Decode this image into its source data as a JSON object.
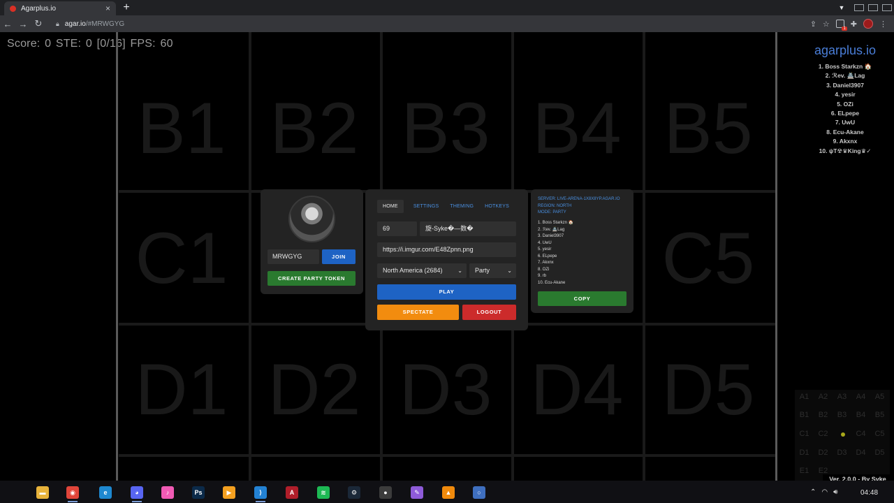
{
  "browser": {
    "tab_title": "Agarplus.io",
    "tab_close": "×",
    "new_tab": "+",
    "url_host": "agar.io",
    "url_path": "/#MRWGYG",
    "back": "←",
    "forward": "→",
    "reload": "↻",
    "extension_badge": "1"
  },
  "hud": {
    "text": "Score: 0  STE: 0  [0/16]  FPS: 60"
  },
  "sectors": {
    "row_b": [
      "B1",
      "B2",
      "B3",
      "B4",
      "B5"
    ],
    "row_c": [
      "C1",
      "C5"
    ],
    "row_d": [
      "D1",
      "D2",
      "D3",
      "D4",
      "D5"
    ]
  },
  "leaderboard": {
    "title": "agarplus.io",
    "entries": [
      "1. Boss Starkzn 🏠",
      "2. ℛev. 🏯Lag",
      "3. Daniel3907",
      "4. yesir",
      "5. OZi",
      "6. ELpepe",
      "7. UwU",
      "8. Ecu-Akane",
      "9. Akxnx",
      "10. ψT☢♛King♛✓"
    ]
  },
  "minimap": {
    "rows": [
      [
        "A1",
        "A2",
        "A3",
        "A4",
        "A5"
      ],
      [
        "B1",
        "B2",
        "B3",
        "B4",
        "B5"
      ],
      [
        "C1",
        "C2",
        "",
        "C4",
        "C5"
      ],
      [
        "D1",
        "D2",
        "D3",
        "D4",
        "D5"
      ],
      [
        "E1",
        "E2",
        "E3",
        "E4",
        "E5"
      ]
    ],
    "player_color": "#a8a81a"
  },
  "version": "Ver. 2.0.0 - By Syke",
  "party_panel": {
    "party_code": "MRWGYG",
    "join_label": "JOIN",
    "create_label": "CREATE PARTY TOKEN"
  },
  "main_panel": {
    "tabs": [
      "HOME",
      "SETTINGS",
      "THEMING",
      "HOTKEYS"
    ],
    "active_tab": "HOME",
    "tag_value": "69",
    "nick_value": "旋-Syke�—数�",
    "skin_value": "https://i.imgur.com/E48Zpnn.png",
    "region_value": "North America (2684)",
    "mode_value": "Party",
    "chevron": "⌄",
    "play_label": "PLAY",
    "spectate_label": "SPECTATE",
    "logout_label": "LOGOUT"
  },
  "server_panel": {
    "server": "SERVER: LIVE-ARENA-1X8X8YP.AGAR.IO",
    "region": "REGION: NORTH",
    "mode": "MODE: PARTY",
    "players": [
      "1. Boss Starkzn 🏠",
      "2. ℛev. 🏯Lag",
      "3. Daniel3907",
      "4. UwU",
      "5. yesir",
      "6. ELpepe",
      "7. Akxnx",
      "8. OZi",
      "9. rb",
      "10. Ecu-Akane"
    ],
    "copy_label": "COPY"
  },
  "taskbar": {
    "time": "04:48",
    "apps": [
      {
        "name": "apple-icon",
        "glyph": "",
        "color": "transparent"
      },
      {
        "name": "file-explorer-icon",
        "glyph": "▬",
        "color": "#e8b33b"
      },
      {
        "name": "chrome-icon",
        "glyph": "◉",
        "color": "#e0453a"
      },
      {
        "name": "edge-icon",
        "glyph": "e",
        "color": "#1e88d0"
      },
      {
        "name": "discord-icon",
        "glyph": "◕",
        "color": "#5865f2"
      },
      {
        "name": "itunes-icon",
        "glyph": "♪",
        "color": "#f15bb5"
      },
      {
        "name": "photoshop-icon",
        "glyph": "Ps",
        "color": "#0b2a49"
      },
      {
        "name": "media-player-icon",
        "glyph": "▶",
        "color": "#f4a020"
      },
      {
        "name": "vscode-icon",
        "glyph": "⟩",
        "color": "#2382d4"
      },
      {
        "name": "app-a-icon",
        "glyph": "A",
        "color": "#b01e2a"
      },
      {
        "name": "spotify-icon",
        "glyph": "≋",
        "color": "#1db954"
      },
      {
        "name": "steam-icon",
        "glyph": "⚙",
        "color": "#1b2838"
      },
      {
        "name": "obs-icon",
        "glyph": "●",
        "color": "#3c3c3c"
      },
      {
        "name": "feather-icon",
        "glyph": "✎",
        "color": "#8e5bd8"
      },
      {
        "name": "vlc-icon",
        "glyph": "▲",
        "color": "#f08a0c"
      },
      {
        "name": "circle-app-icon",
        "glyph": "○",
        "color": "#3f6fbf"
      }
    ]
  }
}
